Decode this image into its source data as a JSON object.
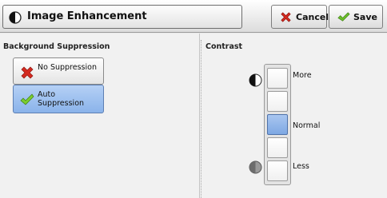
{
  "header": {
    "title": "Image Enhancement",
    "cancel_label": "Cancel",
    "save_label": "Save"
  },
  "background_suppression": {
    "label": "Background Suppression",
    "options": [
      {
        "label": "No Suppression",
        "icon": "red-x-icon",
        "selected": false
      },
      {
        "label": "Auto Suppression",
        "icon": "green-check-icon",
        "selected": true
      }
    ]
  },
  "contrast": {
    "label": "Contrast",
    "levels": 5,
    "selected_level": 3,
    "labels": {
      "more": "More",
      "normal": "Normal",
      "less": "Less"
    }
  },
  "colors": {
    "selected_fill": "#8ab3ea",
    "cancel_red": "#d42a20",
    "save_green": "#6cbf2a"
  }
}
